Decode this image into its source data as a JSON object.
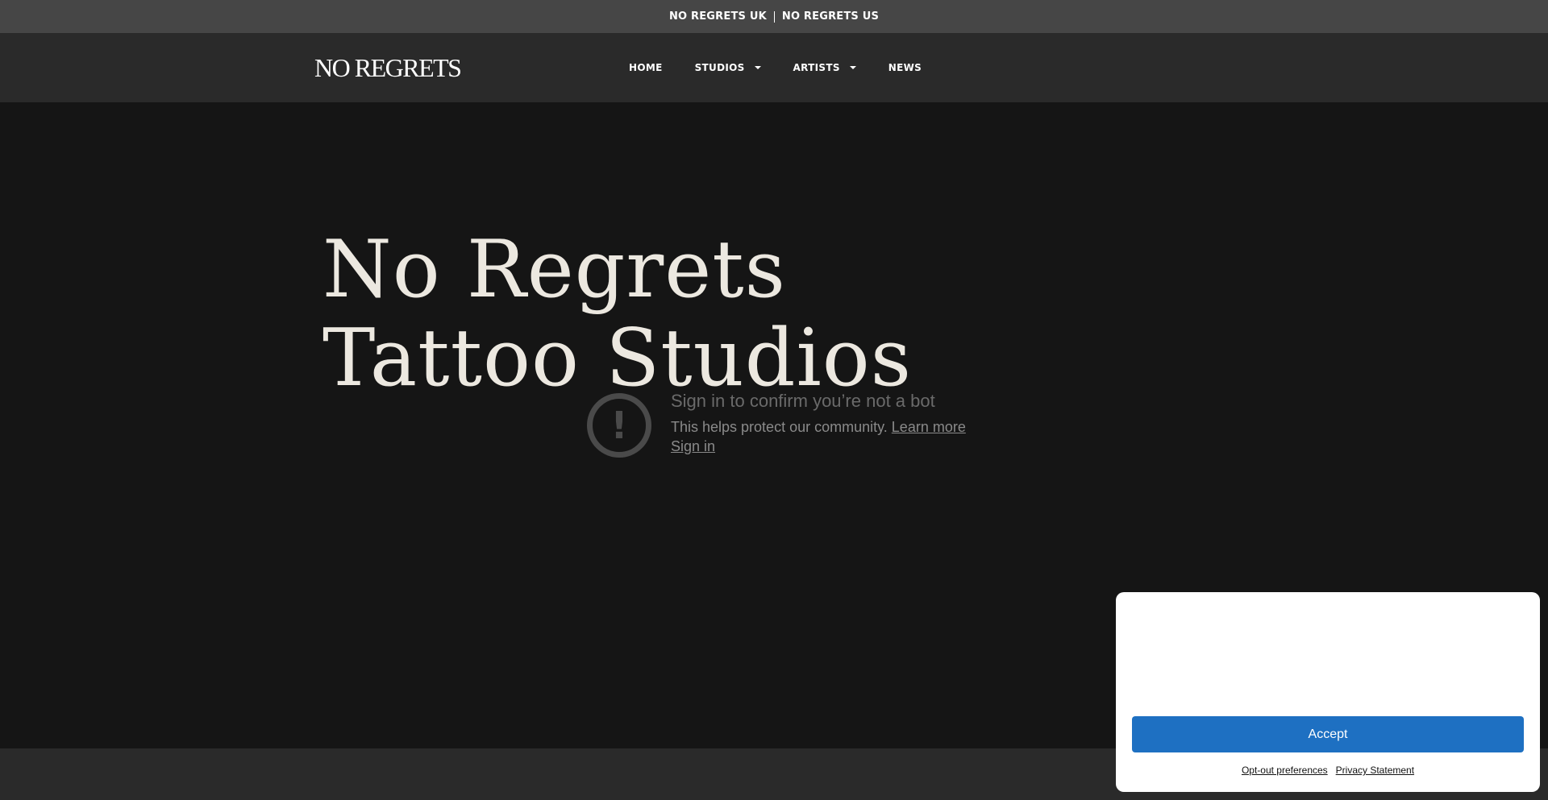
{
  "topbar": {
    "links": [
      "NO REGRETS UK",
      "NO REGRETS US"
    ]
  },
  "header": {
    "logo_text": "NO REGRETS",
    "nav": [
      {
        "label": "HOME",
        "has_dropdown": false
      },
      {
        "label": "STUDIOS",
        "has_dropdown": true
      },
      {
        "label": "ARTISTS",
        "has_dropdown": true
      },
      {
        "label": "NEWS",
        "has_dropdown": false
      }
    ]
  },
  "hero": {
    "title": "No Regrets Tattoo Studios"
  },
  "bot_check": {
    "icon": "alert-circle-icon",
    "heading": "Sign in to confirm you’re not a bot",
    "description": "This helps protect our community.",
    "learn_more": "Learn more",
    "sign_in": "Sign in"
  },
  "cookie_banner": {
    "accept_label": "Accept",
    "opt_out_label": "Opt-out preferences",
    "privacy_label": "Privacy Statement"
  },
  "colors": {
    "topbar_bg": "#464646",
    "navbar_bg": "#2a2a2a",
    "hero_bg": "#151515",
    "hero_text": "#ece8e0",
    "accept_button": "#1e70c2"
  }
}
